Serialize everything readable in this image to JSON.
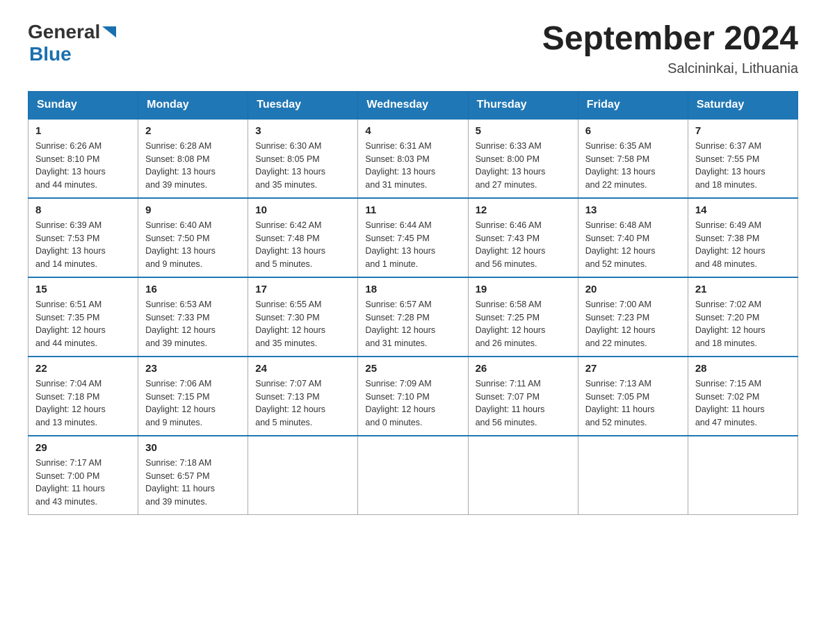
{
  "header": {
    "logo_general": "General",
    "logo_blue": "Blue",
    "title": "September 2024",
    "subtitle": "Salcininkai, Lithuania"
  },
  "days_of_week": [
    "Sunday",
    "Monday",
    "Tuesday",
    "Wednesday",
    "Thursday",
    "Friday",
    "Saturday"
  ],
  "weeks": [
    [
      {
        "day": "1",
        "sunrise": "6:26 AM",
        "sunset": "8:10 PM",
        "daylight": "13 hours and 44 minutes."
      },
      {
        "day": "2",
        "sunrise": "6:28 AM",
        "sunset": "8:08 PM",
        "daylight": "13 hours and 39 minutes."
      },
      {
        "day": "3",
        "sunrise": "6:30 AM",
        "sunset": "8:05 PM",
        "daylight": "13 hours and 35 minutes."
      },
      {
        "day": "4",
        "sunrise": "6:31 AM",
        "sunset": "8:03 PM",
        "daylight": "13 hours and 31 minutes."
      },
      {
        "day": "5",
        "sunrise": "6:33 AM",
        "sunset": "8:00 PM",
        "daylight": "13 hours and 27 minutes."
      },
      {
        "day": "6",
        "sunrise": "6:35 AM",
        "sunset": "7:58 PM",
        "daylight": "13 hours and 22 minutes."
      },
      {
        "day": "7",
        "sunrise": "6:37 AM",
        "sunset": "7:55 PM",
        "daylight": "13 hours and 18 minutes."
      }
    ],
    [
      {
        "day": "8",
        "sunrise": "6:39 AM",
        "sunset": "7:53 PM",
        "daylight": "13 hours and 14 minutes."
      },
      {
        "day": "9",
        "sunrise": "6:40 AM",
        "sunset": "7:50 PM",
        "daylight": "13 hours and 9 minutes."
      },
      {
        "day": "10",
        "sunrise": "6:42 AM",
        "sunset": "7:48 PM",
        "daylight": "13 hours and 5 minutes."
      },
      {
        "day": "11",
        "sunrise": "6:44 AM",
        "sunset": "7:45 PM",
        "daylight": "13 hours and 1 minute."
      },
      {
        "day": "12",
        "sunrise": "6:46 AM",
        "sunset": "7:43 PM",
        "daylight": "12 hours and 56 minutes."
      },
      {
        "day": "13",
        "sunrise": "6:48 AM",
        "sunset": "7:40 PM",
        "daylight": "12 hours and 52 minutes."
      },
      {
        "day": "14",
        "sunrise": "6:49 AM",
        "sunset": "7:38 PM",
        "daylight": "12 hours and 48 minutes."
      }
    ],
    [
      {
        "day": "15",
        "sunrise": "6:51 AM",
        "sunset": "7:35 PM",
        "daylight": "12 hours and 44 minutes."
      },
      {
        "day": "16",
        "sunrise": "6:53 AM",
        "sunset": "7:33 PM",
        "daylight": "12 hours and 39 minutes."
      },
      {
        "day": "17",
        "sunrise": "6:55 AM",
        "sunset": "7:30 PM",
        "daylight": "12 hours and 35 minutes."
      },
      {
        "day": "18",
        "sunrise": "6:57 AM",
        "sunset": "7:28 PM",
        "daylight": "12 hours and 31 minutes."
      },
      {
        "day": "19",
        "sunrise": "6:58 AM",
        "sunset": "7:25 PM",
        "daylight": "12 hours and 26 minutes."
      },
      {
        "day": "20",
        "sunrise": "7:00 AM",
        "sunset": "7:23 PM",
        "daylight": "12 hours and 22 minutes."
      },
      {
        "day": "21",
        "sunrise": "7:02 AM",
        "sunset": "7:20 PM",
        "daylight": "12 hours and 18 minutes."
      }
    ],
    [
      {
        "day": "22",
        "sunrise": "7:04 AM",
        "sunset": "7:18 PM",
        "daylight": "12 hours and 13 minutes."
      },
      {
        "day": "23",
        "sunrise": "7:06 AM",
        "sunset": "7:15 PM",
        "daylight": "12 hours and 9 minutes."
      },
      {
        "day": "24",
        "sunrise": "7:07 AM",
        "sunset": "7:13 PM",
        "daylight": "12 hours and 5 minutes."
      },
      {
        "day": "25",
        "sunrise": "7:09 AM",
        "sunset": "7:10 PM",
        "daylight": "12 hours and 0 minutes."
      },
      {
        "day": "26",
        "sunrise": "7:11 AM",
        "sunset": "7:07 PM",
        "daylight": "11 hours and 56 minutes."
      },
      {
        "day": "27",
        "sunrise": "7:13 AM",
        "sunset": "7:05 PM",
        "daylight": "11 hours and 52 minutes."
      },
      {
        "day": "28",
        "sunrise": "7:15 AM",
        "sunset": "7:02 PM",
        "daylight": "11 hours and 47 minutes."
      }
    ],
    [
      {
        "day": "29",
        "sunrise": "7:17 AM",
        "sunset": "7:00 PM",
        "daylight": "11 hours and 43 minutes."
      },
      {
        "day": "30",
        "sunrise": "7:18 AM",
        "sunset": "6:57 PM",
        "daylight": "11 hours and 39 minutes."
      },
      null,
      null,
      null,
      null,
      null
    ]
  ],
  "labels": {
    "sunrise": "Sunrise:",
    "sunset": "Sunset:",
    "daylight": "Daylight:"
  }
}
